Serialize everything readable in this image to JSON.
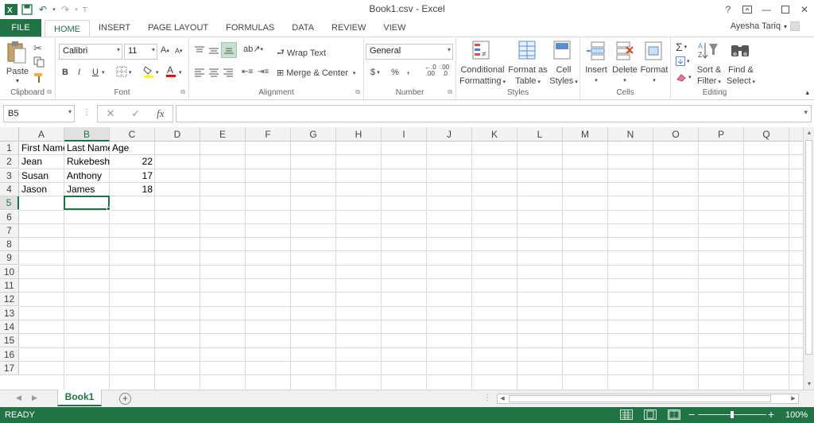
{
  "window": {
    "title": "Book1.csv - Excel",
    "help": "?",
    "user": "Ayesha Tariq"
  },
  "ribbon_tabs": [
    {
      "label": "FILE"
    },
    {
      "label": "HOME",
      "active": true
    },
    {
      "label": "INSERT"
    },
    {
      "label": "PAGE LAYOUT"
    },
    {
      "label": "FORMULAS"
    },
    {
      "label": "DATA"
    },
    {
      "label": "REVIEW"
    },
    {
      "label": "VIEW"
    }
  ],
  "clipboard": {
    "paste": "Paste",
    "label": "Clipboard"
  },
  "font": {
    "name": "Calibri",
    "size": "11",
    "bold": "B",
    "italic": "I",
    "underline": "U",
    "label": "Font",
    "font_color": "#ff0000",
    "highlight_color": "#ffff00"
  },
  "alignment": {
    "wrap_text": "Wrap Text",
    "merge_center": "Merge & Center",
    "label": "Alignment"
  },
  "number": {
    "format": "General",
    "currency": "$",
    "percent": "%",
    "comma": ",",
    "inc_decimal": ".00",
    "dec_decimal": ".0",
    "label": "Number"
  },
  "styles": {
    "conditional_1": "Conditional",
    "conditional_2": "Formatting",
    "format_table_1": "Format as",
    "format_table_2": "Table",
    "cell_styles_1": "Cell",
    "cell_styles_2": "Styles",
    "label": "Styles"
  },
  "cells_group": {
    "insert": "Insert",
    "delete": "Delete",
    "format": "Format",
    "label": "Cells"
  },
  "editing": {
    "sort_filter_1": "Sort &",
    "sort_filter_2": "Filter",
    "find_select_1": "Find &",
    "find_select_2": "Select",
    "label": "Editing"
  },
  "formula_bar": {
    "name_box": "B5",
    "fx": "fx",
    "content": ""
  },
  "columns": [
    "A",
    "B",
    "C",
    "D",
    "E",
    "F",
    "G",
    "H",
    "I",
    "J",
    "K",
    "L",
    "M",
    "N",
    "O",
    "P",
    "Q"
  ],
  "rows": [
    "1",
    "2",
    "3",
    "4",
    "5",
    "6",
    "7",
    "8",
    "9",
    "10",
    "11",
    "12",
    "13",
    "14",
    "15",
    "16",
    "17"
  ],
  "cells": {
    "A1": "First Name",
    "B1": "Last Name",
    "C1": "Age",
    "A2": "Jean",
    "B2": "Rukebesha",
    "C2": "22",
    "A3": "Susan",
    "B3": "Anthony",
    "C3": "17",
    "A4": "Jason",
    "B4": "James",
    "C4": "18"
  },
  "selected_cell": "B5",
  "sheet": {
    "name": "Book1",
    "add": "+"
  },
  "status": {
    "text": "READY",
    "zoom": "100%",
    "zoom_minus": "−",
    "zoom_plus": "+"
  },
  "accent_color": "#217346"
}
